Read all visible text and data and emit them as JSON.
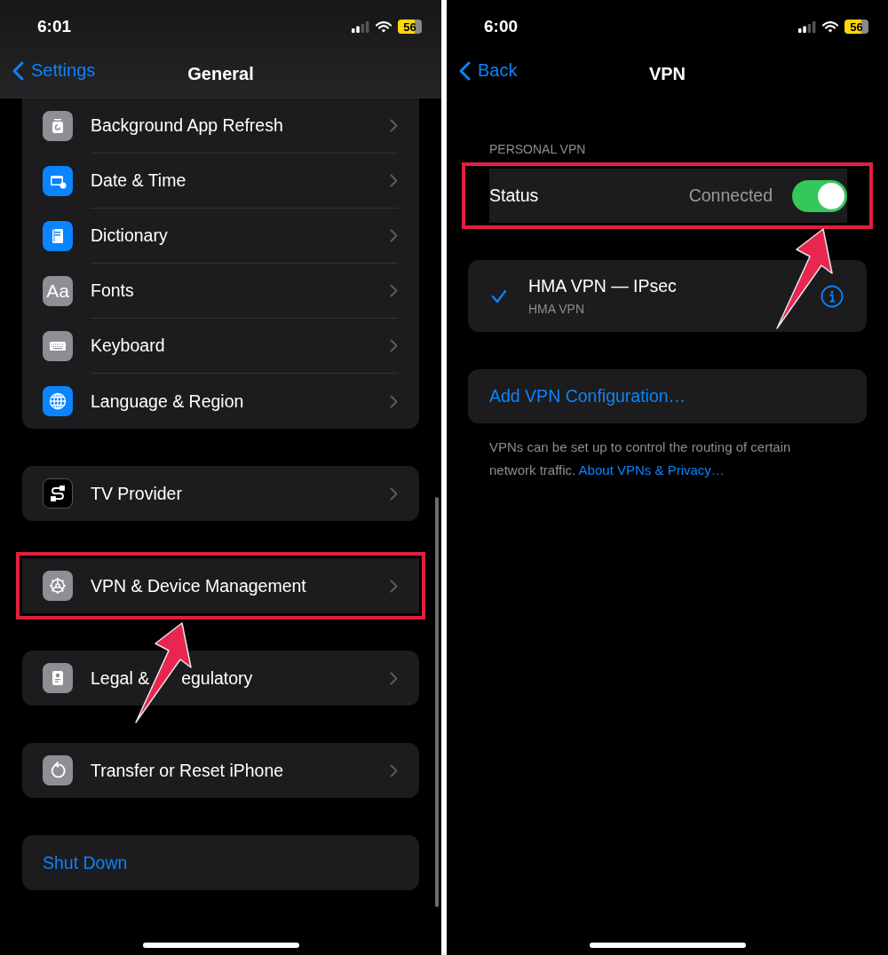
{
  "general_screen": {
    "status_bar": {
      "time": "6:01",
      "battery": "56"
    },
    "nav": {
      "back_label": "Settings",
      "title": "General"
    },
    "groups": [
      {
        "highlighted": false,
        "rows": [
          {
            "kind": "nav",
            "label": "Background App Refresh"
          },
          {
            "kind": "nav",
            "label": "Date & Time"
          },
          {
            "kind": "nav",
            "label": "Dictionary"
          },
          {
            "kind": "nav",
            "label": "Fonts",
            "icon_text": "Aa"
          },
          {
            "kind": "nav",
            "label": "Keyboard"
          },
          {
            "kind": "nav",
            "label": "Language & Region"
          }
        ]
      },
      {
        "highlighted": false,
        "rows": [
          {
            "kind": "nav",
            "label": "TV Provider"
          }
        ]
      },
      {
        "highlighted": true,
        "rows": [
          {
            "kind": "nav",
            "label": "VPN & Device Management"
          }
        ]
      },
      {
        "highlighted": false,
        "rows": [
          {
            "kind": "nav",
            "label_parts": [
              "Legal &",
              "egulatory"
            ]
          }
        ]
      },
      {
        "highlighted": false,
        "rows": [
          {
            "kind": "nav",
            "label": "Transfer or Reset iPhone"
          }
        ]
      },
      {
        "highlighted": false,
        "rows": [
          {
            "kind": "action",
            "label": "Shut Down"
          }
        ]
      }
    ]
  },
  "vpn_screen": {
    "status_bar": {
      "time": "6:00",
      "battery": "56"
    },
    "nav": {
      "back_label": "Back",
      "title": "VPN"
    },
    "section_header": "PERSONAL VPN",
    "status_row": {
      "label": "Status",
      "value": "Connected",
      "on": true,
      "highlighted": true
    },
    "configurations": [
      {
        "name": "HMA VPN — IPsec",
        "subtitle": "HMA VPN",
        "selected": true
      }
    ],
    "add_button": "Add VPN Configuration…",
    "footer": {
      "text": "VPNs can be set up to control the routing of certain network traffic.",
      "link": "About VPNs & Privacy…"
    }
  }
}
